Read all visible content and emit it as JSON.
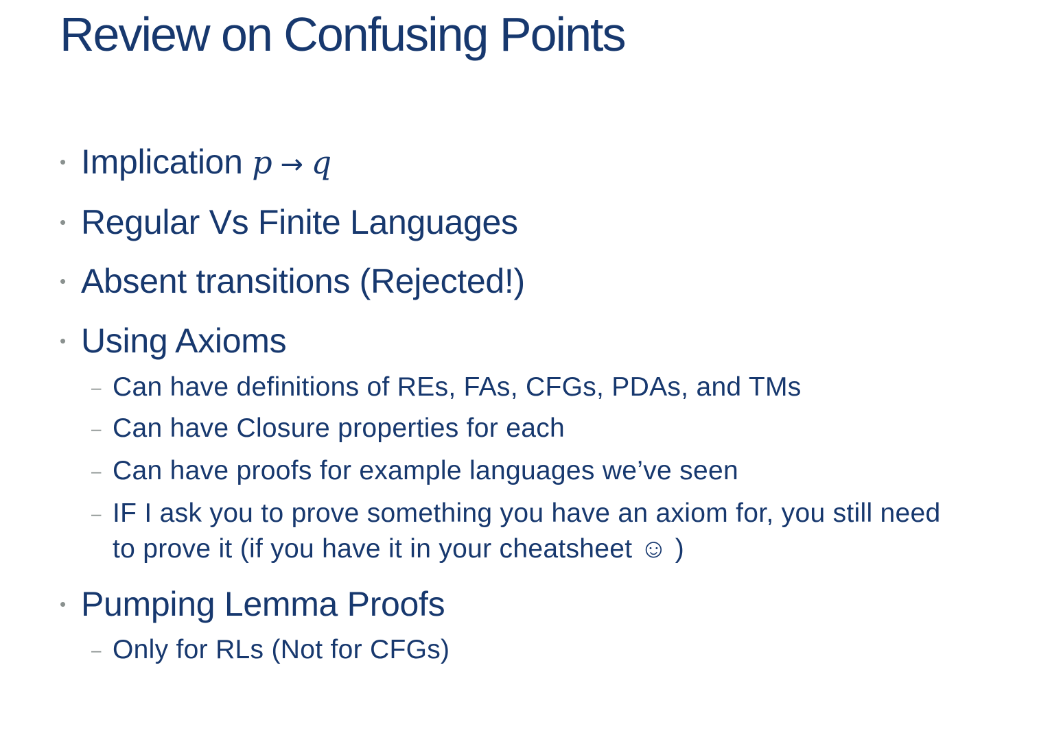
{
  "slide": {
    "title": "Review on Confusing Points",
    "bullets": [
      {
        "text": "Implication ",
        "math_p": "p",
        "math_arrow": "→",
        "math_q": "q"
      },
      {
        "text": "Regular Vs Finite Languages"
      },
      {
        "text": "Absent transitions (Rejected!)"
      },
      {
        "text": "Using Axioms",
        "subitems": [
          "Can have definitions of REs, FAs, CFGs, PDAs, and TMs",
          "Can have Closure properties for each",
          "Can have proofs for example languages we’ve seen",
          "IF I ask you to prove something you have an axiom for, you still need to prove it (if you have it in your cheatsheet ☺ )"
        ]
      },
      {
        "text": "Pumping Lemma Proofs",
        "subitems": [
          "Only for RLs (Not for CFGs)"
        ]
      }
    ],
    "bullet_glyph": "•",
    "dash_glyph": "–",
    "colors": {
      "title": "#17386e",
      "text": "#17386e",
      "bullet": "#8a918f",
      "background": "#ffffff"
    }
  }
}
